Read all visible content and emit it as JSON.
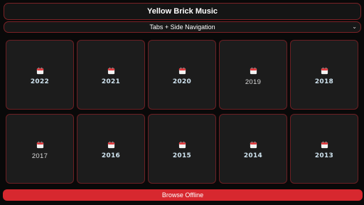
{
  "header": {
    "title": "Yellow Brick Music"
  },
  "navigation": {
    "selected_value": "Tabs + Side Navigation",
    "icon": "chevron-down-icon"
  },
  "years": [
    {
      "label": "2022",
      "style": "bold"
    },
    {
      "label": "2021",
      "style": "bold"
    },
    {
      "label": "2020",
      "style": "bold"
    },
    {
      "label": "2019",
      "style": "plain"
    },
    {
      "label": "2018",
      "style": "bold"
    },
    {
      "label": "2017",
      "style": "plain"
    },
    {
      "label": "2016",
      "style": "bold"
    },
    {
      "label": "2015",
      "style": "bold"
    },
    {
      "label": "2014",
      "style": "bold"
    },
    {
      "label": "2013",
      "style": "bold"
    }
  ],
  "tile_icon": "calendar-icon",
  "footer": {
    "browse_label": "Browse Offline"
  },
  "colors": {
    "accent": "#d7282f",
    "border": "#7a2226",
    "tile_bg": "#1c1c1c",
    "background": "#090909"
  }
}
